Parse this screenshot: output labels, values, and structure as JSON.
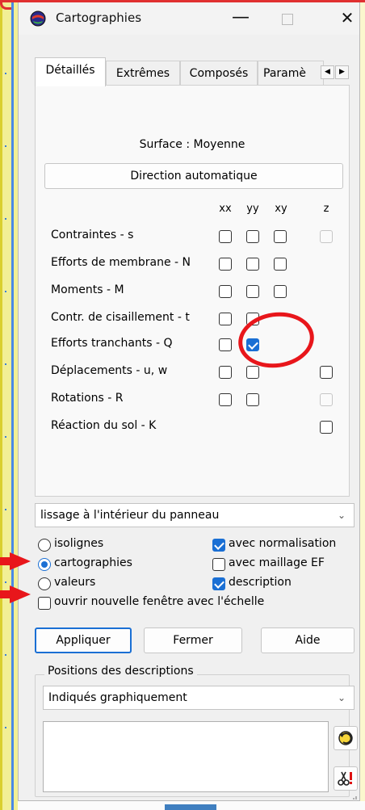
{
  "window": {
    "title": "Cartographies"
  },
  "tabs": [
    "Détaillés",
    "Extrêmes",
    "Composés",
    "Paramè"
  ],
  "surface_label": "Surface : Moyenne",
  "direction_button": "Direction automatique",
  "columns": [
    "xx",
    "yy",
    "xy",
    "z"
  ],
  "rows": [
    {
      "label": "Contraintes - s",
      "xx": "unchecked",
      "yy": "unchecked",
      "xy": "unchecked",
      "z": "disabled"
    },
    {
      "label": "Efforts de membrane - N",
      "xx": "unchecked",
      "yy": "unchecked",
      "xy": "unchecked",
      "z": "none"
    },
    {
      "label": "Moments - M",
      "xx": "unchecked",
      "yy": "unchecked",
      "xy": "unchecked",
      "z": "none"
    },
    {
      "label": "Contr. de cisaillement - t",
      "xx": "unchecked",
      "yy": "unchecked",
      "xy": "none",
      "z": "none"
    },
    {
      "label": "Efforts tranchants - Q",
      "xx": "unchecked",
      "yy": "checked",
      "xy": "none",
      "z": "none"
    },
    {
      "label": "Déplacements - u, w",
      "xx": "unchecked",
      "yy": "unchecked",
      "xy": "none",
      "z": "unchecked"
    },
    {
      "label": "Rotations - R",
      "xx": "unchecked",
      "yy": "unchecked",
      "xy": "none",
      "z": "disabled"
    },
    {
      "label": "Réaction du sol - K",
      "xx": "none",
      "yy": "none",
      "xy": "none",
      "z": "unchecked"
    }
  ],
  "smoothing_select": "lissage à l'intérieur du panneau",
  "display_options": {
    "isolignes": "isolignes",
    "cartographies": "cartographies",
    "valeurs": "valeurs",
    "selected": "cartographies"
  },
  "checkbox_options": {
    "normalisation": {
      "label": "avec normalisation",
      "checked": true
    },
    "maillage": {
      "label": "avec maillage EF",
      "checked": false
    },
    "description": {
      "label": "description",
      "checked": true
    },
    "nouvelle_fenetre": {
      "label": "ouvrir nouvelle fenêtre avec l'échelle",
      "checked": false
    }
  },
  "buttons": {
    "apply": "Appliquer",
    "close": "Fermer",
    "help": "Aide"
  },
  "positions_group": {
    "label": "Positions des descriptions",
    "select_value": "Indiqués graphiquement"
  },
  "icons": {
    "app": "globe-icon",
    "minimize": "minimize-icon",
    "maximize": "maximize-icon",
    "close": "close-icon",
    "undo": "undo-icon",
    "cut_alert": "scissors-alert-icon"
  },
  "colors": {
    "accent": "#1a6fd4",
    "annotation_red": "#e8161b"
  }
}
